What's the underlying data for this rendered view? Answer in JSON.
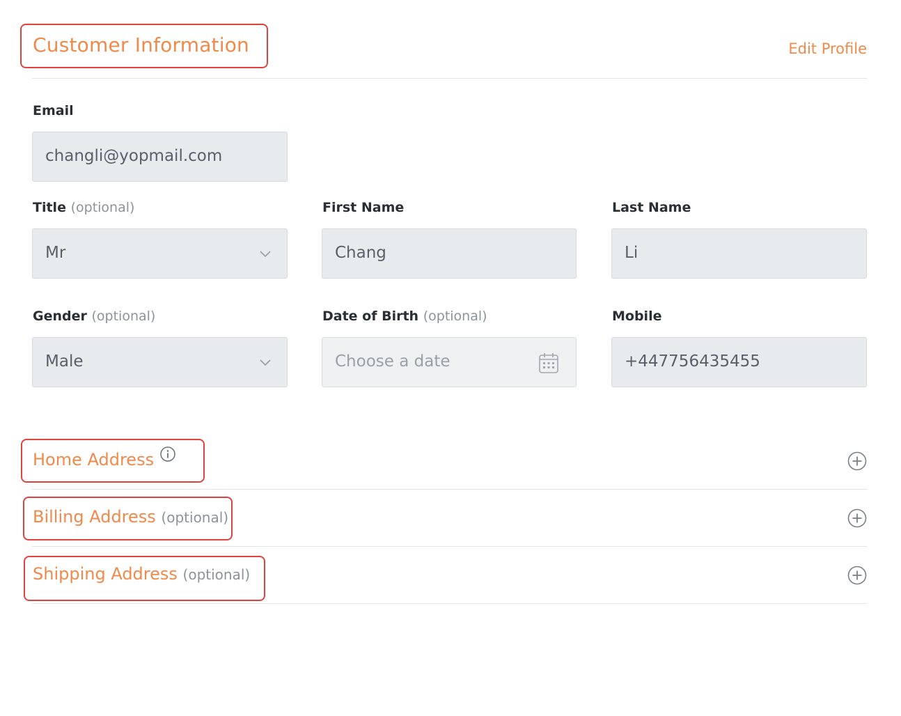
{
  "header": {
    "title": "Customer Information",
    "edit_label": "Edit Profile"
  },
  "form": {
    "email": {
      "label": "Email",
      "value": "changli@yopmail.com"
    },
    "title": {
      "label": "Title",
      "optional": "(optional)",
      "value": "Mr"
    },
    "first_name": {
      "label": "First Name",
      "value": "Chang"
    },
    "last_name": {
      "label": "Last Name",
      "value": "Li"
    },
    "gender": {
      "label": "Gender",
      "optional": "(optional)",
      "value": "Male"
    },
    "dob": {
      "label": "Date of Birth",
      "optional": "(optional)",
      "placeholder": "Choose a date"
    },
    "mobile": {
      "label": "Mobile",
      "value": "+447756435455"
    }
  },
  "sections": {
    "home": {
      "label": "Home Address"
    },
    "billing": {
      "label": "Billing Address",
      "optional": "(optional)"
    },
    "shipping": {
      "label": "Shipping Address",
      "optional": "(optional)"
    }
  },
  "icons": {
    "dropdown": "chevron-down-icon",
    "calendar": "calendar-icon",
    "info": "info-icon",
    "expand": "plus-circle-icon"
  },
  "colors": {
    "accent": "#f08a4b",
    "highlight_border": "#e2423e",
    "field_bg": "#e8ebee"
  }
}
